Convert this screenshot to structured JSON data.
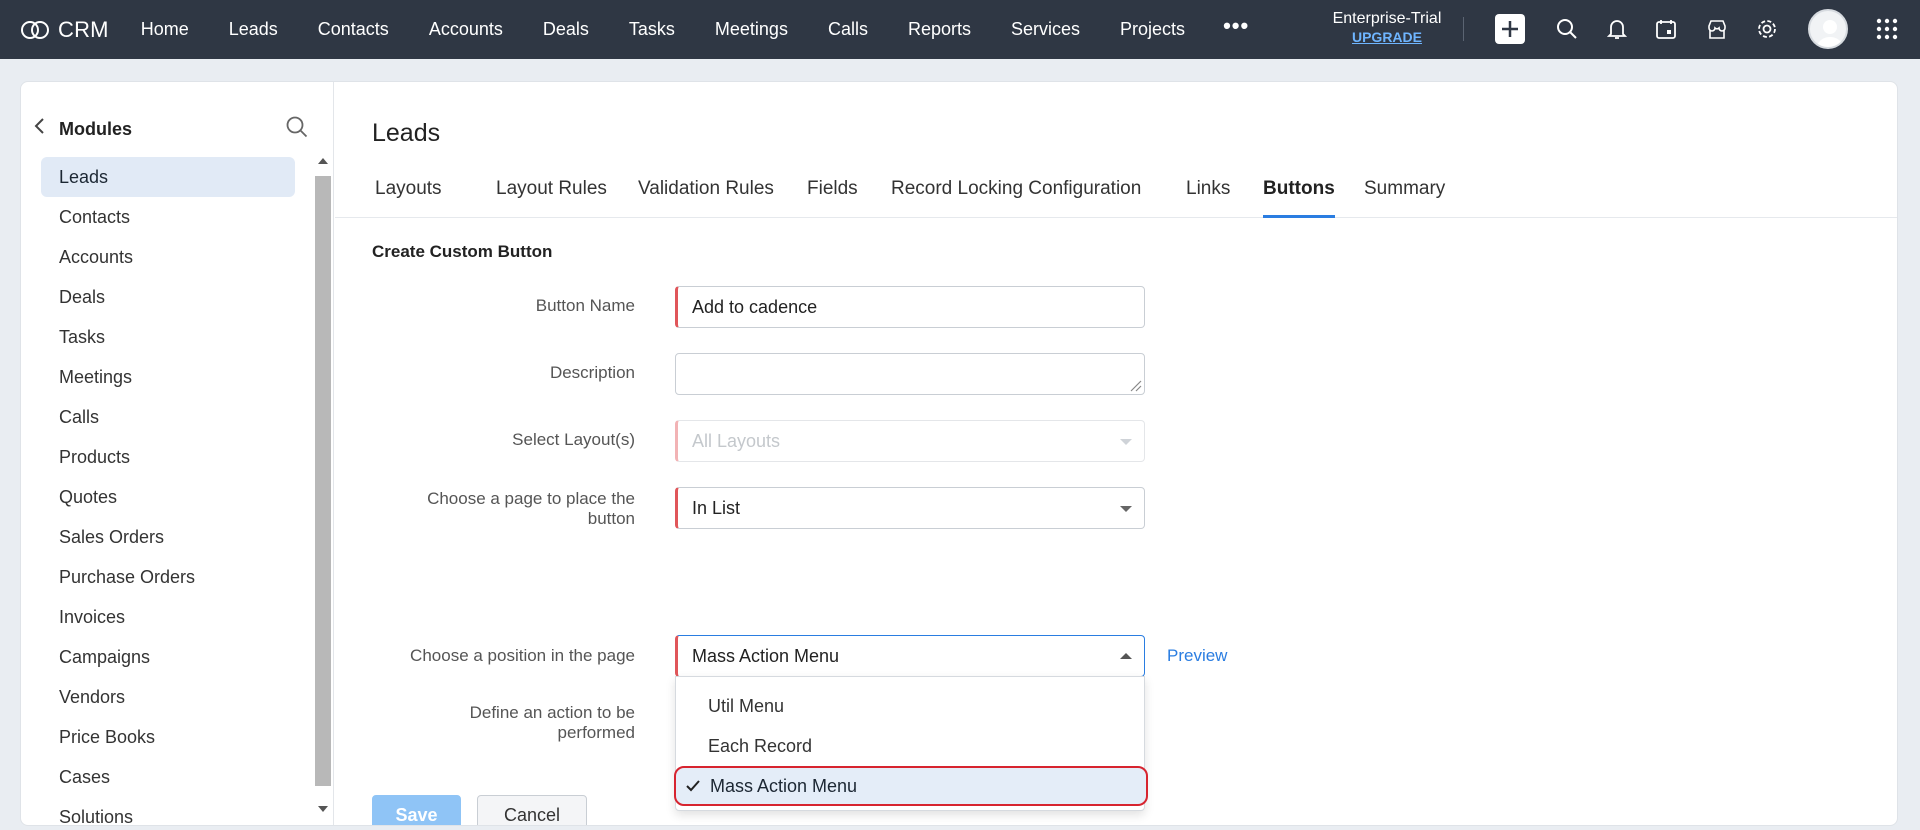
{
  "app": {
    "logo_text": "CRM",
    "nav": [
      "Home",
      "Leads",
      "Contacts",
      "Accounts",
      "Deals",
      "Tasks",
      "Meetings",
      "Calls",
      "Reports",
      "Services",
      "Projects"
    ],
    "more_label": "•••",
    "trial_name": "Enterprise-Trial",
    "upgrade_label": "UPGRADE",
    "icons": [
      "plus-icon",
      "search-icon",
      "bell-icon",
      "calendar-icon",
      "marketplace-icon",
      "gear-icon",
      "avatar",
      "apps-grid-icon"
    ]
  },
  "sidebar": {
    "title": "Modules",
    "items": [
      "Leads",
      "Contacts",
      "Accounts",
      "Deals",
      "Tasks",
      "Meetings",
      "Calls",
      "Products",
      "Quotes",
      "Sales Orders",
      "Purchase Orders",
      "Invoices",
      "Campaigns",
      "Vendors",
      "Price Books",
      "Cases",
      "Solutions"
    ],
    "active_item": "Leads"
  },
  "main": {
    "title": "Leads",
    "tabs": [
      "Layouts",
      "Layout Rules",
      "Validation Rules",
      "Fields",
      "Record Locking Configuration",
      "Links",
      "Buttons",
      "Summary"
    ],
    "active_tab": "Buttons",
    "section_title": "Create Custom Button"
  },
  "form": {
    "button_name_label": "Button Name",
    "button_name_value": "Add to cadence",
    "description_label": "Description",
    "description_value": "",
    "layouts_label": "Select Layout(s)",
    "layouts_value": "All Layouts",
    "page_label_line1": "Choose a page to place the",
    "page_label_line2": "button",
    "page_value": "In List",
    "position_label": "Choose a position in the page",
    "position_value": "Mass Action Menu",
    "preview_label": "Preview",
    "action_label_line1": "Define an action to be",
    "action_label_line2": "performed",
    "save_label": "Save",
    "cancel_label": "Cancel"
  },
  "dropdown": {
    "options": [
      "Util Menu",
      "Each Record",
      "Mass Action Menu"
    ],
    "selected": "Mass Action Menu"
  },
  "colors": {
    "topbar": "#2f3744",
    "accent": "#2a7de1",
    "required": "#e0565a",
    "highlight_ring": "#d7242f",
    "save_disabled": "#8fc4f6"
  }
}
